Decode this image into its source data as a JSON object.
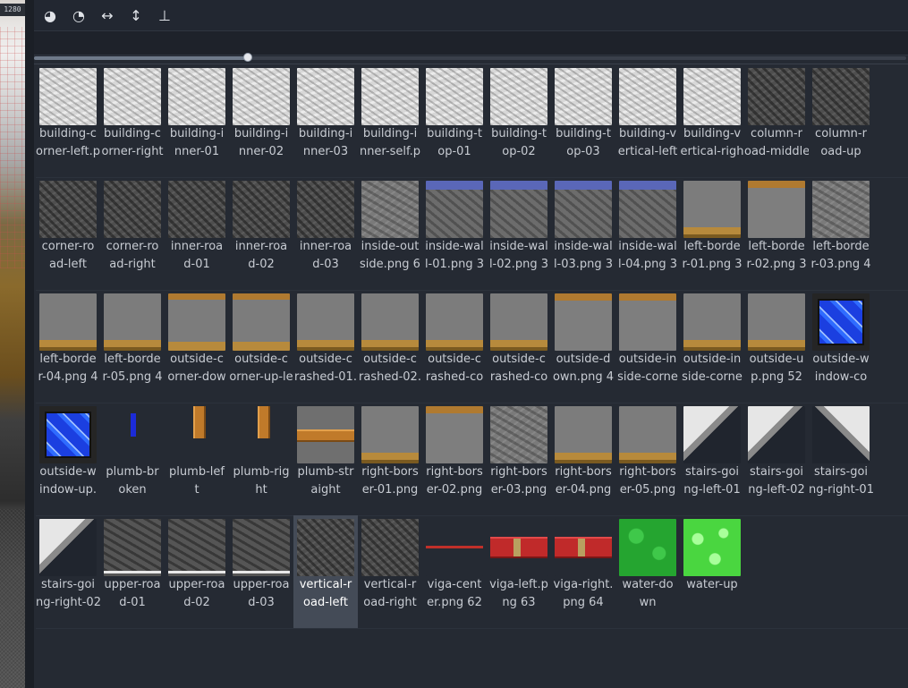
{
  "left_strip": {
    "ruler_label": "1280"
  },
  "toolbar": {
    "buttons": [
      {
        "name": "pie-full-icon",
        "glyph": "◕"
      },
      {
        "name": "pie-half-icon",
        "glyph": "◔"
      },
      {
        "name": "horizontal-arrows-icon",
        "glyph": "↔"
      },
      {
        "name": "vertical-arrows-icon",
        "glyph": "↕"
      },
      {
        "name": "stamp-icon",
        "glyph": "⊥"
      }
    ]
  },
  "slider": {
    "value": 0.245
  },
  "selected_index": 56,
  "tiles": [
    {
      "l1": "building-c",
      "l2": "orner-left.p",
      "kind": "light"
    },
    {
      "l1": "building-c",
      "l2": "orner-right",
      "kind": "light"
    },
    {
      "l1": "building-i",
      "l2": "nner-01",
      "kind": "light"
    },
    {
      "l1": "building-i",
      "l2": "nner-02",
      "kind": "light"
    },
    {
      "l1": "building-i",
      "l2": "nner-03",
      "kind": "light"
    },
    {
      "l1": "building-i",
      "l2": "nner-self.p",
      "kind": "light"
    },
    {
      "l1": "building-t",
      "l2": "op-01",
      "kind": "light"
    },
    {
      "l1": "building-t",
      "l2": "op-02",
      "kind": "light"
    },
    {
      "l1": "building-t",
      "l2": "op-03",
      "kind": "light"
    },
    {
      "l1": "building-v",
      "l2": "ertical-left",
      "kind": "light"
    },
    {
      "l1": "building-v",
      "l2": "ertical-righ",
      "kind": "light"
    },
    {
      "l1": "column-r",
      "l2": "oad-middle",
      "kind": "dark"
    },
    {
      "l1": "column-r",
      "l2": "oad-up",
      "kind": "dark"
    },
    {
      "l1": "corner-ro",
      "l2": "ad-left",
      "kind": "dark"
    },
    {
      "l1": "corner-ro",
      "l2": "ad-right",
      "kind": "dark"
    },
    {
      "l1": "inner-roa",
      "l2": "d-01",
      "kind": "dark"
    },
    {
      "l1": "inner-roa",
      "l2": "d-02",
      "kind": "dark"
    },
    {
      "l1": "inner-roa",
      "l2": "d-03",
      "kind": "dark"
    },
    {
      "l1": "inside-out",
      "l2": "side.png 6",
      "kind": "gray"
    },
    {
      "l1": "inside-wal",
      "l2": "l-01.png 3",
      "kind": "wall"
    },
    {
      "l1": "inside-wal",
      "l2": "l-02.png 3",
      "kind": "wall"
    },
    {
      "l1": "inside-wal",
      "l2": "l-03.png 3",
      "kind": "wall"
    },
    {
      "l1": "inside-wal",
      "l2": "l-04.png 3",
      "kind": "wall"
    },
    {
      "l1": "left-borde",
      "l2": "r-01.png 3",
      "kind": "brownbot"
    },
    {
      "l1": "left-borde",
      "l2": "r-02.png 3",
      "kind": "browntop"
    },
    {
      "l1": "left-borde",
      "l2": "r-03.png 4",
      "kind": "gray"
    },
    {
      "l1": "left-borde",
      "l2": "r-04.png 4",
      "kind": "brownbot"
    },
    {
      "l1": "left-borde",
      "l2": "r-05.png 4",
      "kind": "brownbot"
    },
    {
      "l1": "outside-c",
      "l2": "orner-dow",
      "kind": "brownboth"
    },
    {
      "l1": "outside-c",
      "l2": "orner-up-le",
      "kind": "brownboth"
    },
    {
      "l1": "outside-c",
      "l2": "rashed-01.",
      "kind": "brownbot"
    },
    {
      "l1": "outside-c",
      "l2": "rashed-02.",
      "kind": "brownbot"
    },
    {
      "l1": "outside-c",
      "l2": "rashed-co",
      "kind": "brownbot"
    },
    {
      "l1": "outside-c",
      "l2": "rashed-co",
      "kind": "brownbot"
    },
    {
      "l1": "outside-d",
      "l2": "own.png 4",
      "kind": "browntop"
    },
    {
      "l1": "outside-in",
      "l2": "side-corne",
      "kind": "browntop"
    },
    {
      "l1": "outside-in",
      "l2": "side-corne",
      "kind": "brownbot"
    },
    {
      "l1": "outside-u",
      "l2": "p.png 52",
      "kind": "brownbot"
    },
    {
      "l1": "outside-w",
      "l2": "indow-co",
      "kind": "window"
    },
    {
      "l1": "outside-w",
      "l2": "indow-up.",
      "kind": "window"
    },
    {
      "l1": "plumb-br",
      "l2": "oken",
      "kind": "pipebroken"
    },
    {
      "l1": "plumb-lef",
      "l2": "t",
      "kind": "pipev"
    },
    {
      "l1": "plumb-rig",
      "l2": "ht",
      "kind": "pipev"
    },
    {
      "l1": "plumb-str",
      "l2": "aight",
      "kind": "pipe"
    },
    {
      "l1": "right-bors",
      "l2": "er-01.png",
      "kind": "brownbot"
    },
    {
      "l1": "right-bors",
      "l2": "er-02.png",
      "kind": "browntop"
    },
    {
      "l1": "right-bors",
      "l2": "er-03.png",
      "kind": "gray"
    },
    {
      "l1": "right-bors",
      "l2": "er-04.png",
      "kind": "brownbot"
    },
    {
      "l1": "right-bors",
      "l2": "er-05.png",
      "kind": "brownbot"
    },
    {
      "l1": "stairs-goi",
      "l2": "ng-left-01",
      "kind": "stairs"
    },
    {
      "l1": "stairs-goi",
      "l2": "ng-left-02",
      "kind": "stairs"
    },
    {
      "l1": "stairs-goi",
      "l2": "ng-right-01",
      "kind": "stairs2"
    },
    {
      "l1": "stairs-goi",
      "l2": "ng-right-02",
      "kind": "stairs3"
    },
    {
      "l1": "upper-roa",
      "l2": "d-01",
      "kind": "upper"
    },
    {
      "l1": "upper-roa",
      "l2": "d-02",
      "kind": "upper"
    },
    {
      "l1": "upper-roa",
      "l2": "d-03",
      "kind": "upper"
    },
    {
      "l1": "vertical-r",
      "l2": "oad-left",
      "kind": "dark"
    },
    {
      "l1": "vertical-r",
      "l2": "oad-right",
      "kind": "dark"
    },
    {
      "l1": "viga-cent",
      "l2": "er.png 62",
      "kind": "viga"
    },
    {
      "l1": "viga-left.p",
      "l2": "ng 63",
      "kind": "vigabig"
    },
    {
      "l1": "viga-right.",
      "l2": "png 64",
      "kind": "vigabig"
    },
    {
      "l1": "water-do",
      "l2": "wn",
      "kind": "water"
    },
    {
      "l1": "water-up",
      "l2": "",
      "kind": "water2"
    }
  ]
}
